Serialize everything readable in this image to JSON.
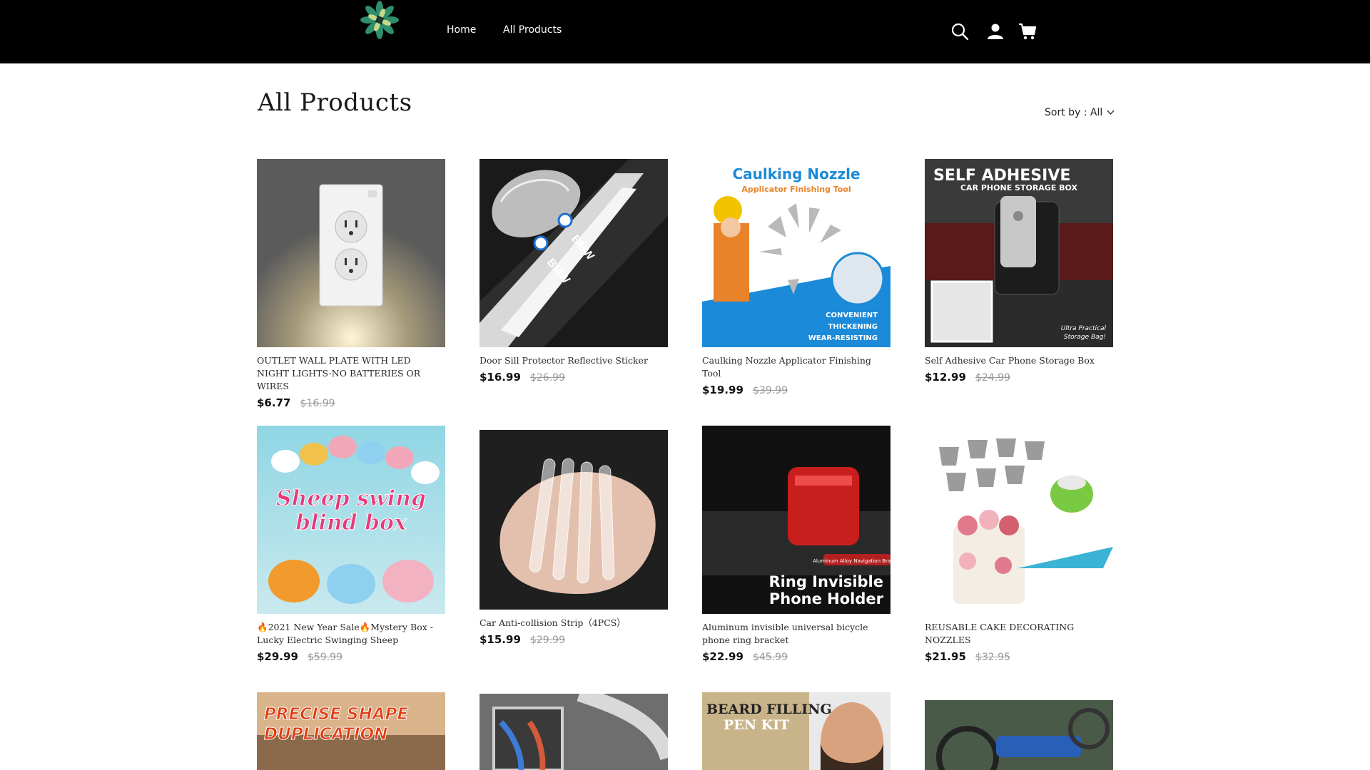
{
  "nav": {
    "home": "Home",
    "all_products": "All Products",
    "icons": [
      "search-icon",
      "account-icon",
      "cart-icon"
    ]
  },
  "page": {
    "title": "All Products",
    "sort_label": "Sort by : All"
  },
  "products": [
    {
      "title": "OUTLET WALL PLATE WITH LED NIGHT LIGHTS-NO BATTERIES OR WIRES",
      "price": "$6.77",
      "compare_price": "$16.99"
    },
    {
      "title": "Door Sill Protector Reflective Sticker",
      "price": "$16.99",
      "compare_price": "$26.99",
      "image_text": [
        "BMW",
        "BMW"
      ]
    },
    {
      "title": "Caulking Nozzle Applicator Finishing Tool",
      "price": "$19.99",
      "compare_price": "$39.99",
      "image_text": [
        "Caulking Nozzle",
        "Applicator Finishing Tool",
        "CONVENIENT",
        "THICKENING",
        "WEAR-RESISTING"
      ]
    },
    {
      "title": "Self Adhesive Car Phone Storage Box",
      "price": "$12.99",
      "compare_price": "$24.99",
      "image_text": [
        "SELF ADHESIVE",
        "CAR PHONE STORAGE BOX",
        "Ultra Practical",
        "Storage Bag!"
      ]
    },
    {
      "title": "🔥2021 New Year Sale🔥Mystery Box -Lucky Electric Swinging Sheep",
      "price": "$29.99",
      "compare_price": "$59.99",
      "image_text": [
        "Sheep swing",
        "blind box"
      ]
    },
    {
      "title": "Car Anti-collision Strip（4PCS）",
      "price": "$15.99",
      "compare_price": "$29.99"
    },
    {
      "title": "Aluminum invisible universal bicycle phone ring bracket",
      "price": "$22.99",
      "compare_price": "$45.99",
      "image_text": [
        "Aluminum Alloy Navigation Bracket",
        "Ring Invisible",
        "Phone Holder"
      ]
    },
    {
      "title": "REUSABLE CAKE DECORATING NOZZLES",
      "price": "$21.95",
      "compare_price": "$32.95"
    },
    {
      "image_text": [
        "PRECISE SHAPE",
        "DUPLICATION"
      ]
    },
    {},
    {
      "image_text": [
        "BEARD FILLING",
        "PEN KIT"
      ]
    },
    {}
  ],
  "colors": {
    "header_bg": "#000000",
    "page_bg": "#ffffff",
    "price": "#111111",
    "compare_price": "#999999"
  }
}
